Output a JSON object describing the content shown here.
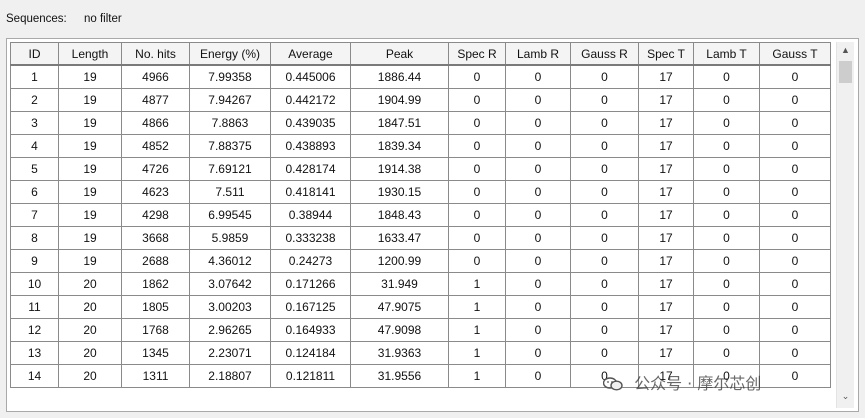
{
  "filter": {
    "label": "Sequences:",
    "value": "no filter"
  },
  "table": {
    "columns": [
      "ID",
      "Length",
      "No. hits",
      "Energy (%)",
      "Average",
      "Peak",
      "Spec R",
      "Lamb R",
      "Gauss R",
      "Spec T",
      "Lamb T",
      "Gauss T"
    ],
    "rows": [
      [
        "1",
        "19",
        "4966",
        "7.99358",
        "0.445006",
        "1886.44",
        "0",
        "0",
        "0",
        "17",
        "0",
        "0"
      ],
      [
        "2",
        "19",
        "4877",
        "7.94267",
        "0.442172",
        "1904.99",
        "0",
        "0",
        "0",
        "17",
        "0",
        "0"
      ],
      [
        "3",
        "19",
        "4866",
        "7.8863",
        "0.439035",
        "1847.51",
        "0",
        "0",
        "0",
        "17",
        "0",
        "0"
      ],
      [
        "4",
        "19",
        "4852",
        "7.88375",
        "0.438893",
        "1839.34",
        "0",
        "0",
        "0",
        "17",
        "0",
        "0"
      ],
      [
        "5",
        "19",
        "4726",
        "7.69121",
        "0.428174",
        "1914.38",
        "0",
        "0",
        "0",
        "17",
        "0",
        "0"
      ],
      [
        "6",
        "19",
        "4623",
        "7.511",
        "0.418141",
        "1930.15",
        "0",
        "0",
        "0",
        "17",
        "0",
        "0"
      ],
      [
        "7",
        "19",
        "4298",
        "6.99545",
        "0.38944",
        "1848.43",
        "0",
        "0",
        "0",
        "17",
        "0",
        "0"
      ],
      [
        "8",
        "19",
        "3668",
        "5.9859",
        "0.333238",
        "1633.47",
        "0",
        "0",
        "0",
        "17",
        "0",
        "0"
      ],
      [
        "9",
        "19",
        "2688",
        "4.36012",
        "0.24273",
        "1200.99",
        "0",
        "0",
        "0",
        "17",
        "0",
        "0"
      ],
      [
        "10",
        "20",
        "1862",
        "3.07642",
        "0.171266",
        "31.949",
        "1",
        "0",
        "0",
        "17",
        "0",
        "0"
      ],
      [
        "11",
        "20",
        "1805",
        "3.00203",
        "0.167125",
        "47.9075",
        "1",
        "0",
        "0",
        "17",
        "0",
        "0"
      ],
      [
        "12",
        "20",
        "1768",
        "2.96265",
        "0.164933",
        "47.9098",
        "1",
        "0",
        "0",
        "17",
        "0",
        "0"
      ],
      [
        "13",
        "20",
        "1345",
        "2.23071",
        "0.124184",
        "31.9363",
        "1",
        "0",
        "0",
        "17",
        "0",
        "0"
      ],
      [
        "14",
        "20",
        "1311",
        "2.18807",
        "0.121811",
        "31.9556",
        "1",
        "0",
        "0",
        "17",
        "0",
        "0"
      ]
    ]
  },
  "scrollbar": {
    "up_icon": "triangle-up-icon",
    "down_icon": "chevron-down-icon",
    "up_glyph": "▲",
    "down_glyph": "⌄"
  },
  "watermark": {
    "icon": "wechat-icon",
    "text": "公众号 · 摩尔芯创"
  }
}
